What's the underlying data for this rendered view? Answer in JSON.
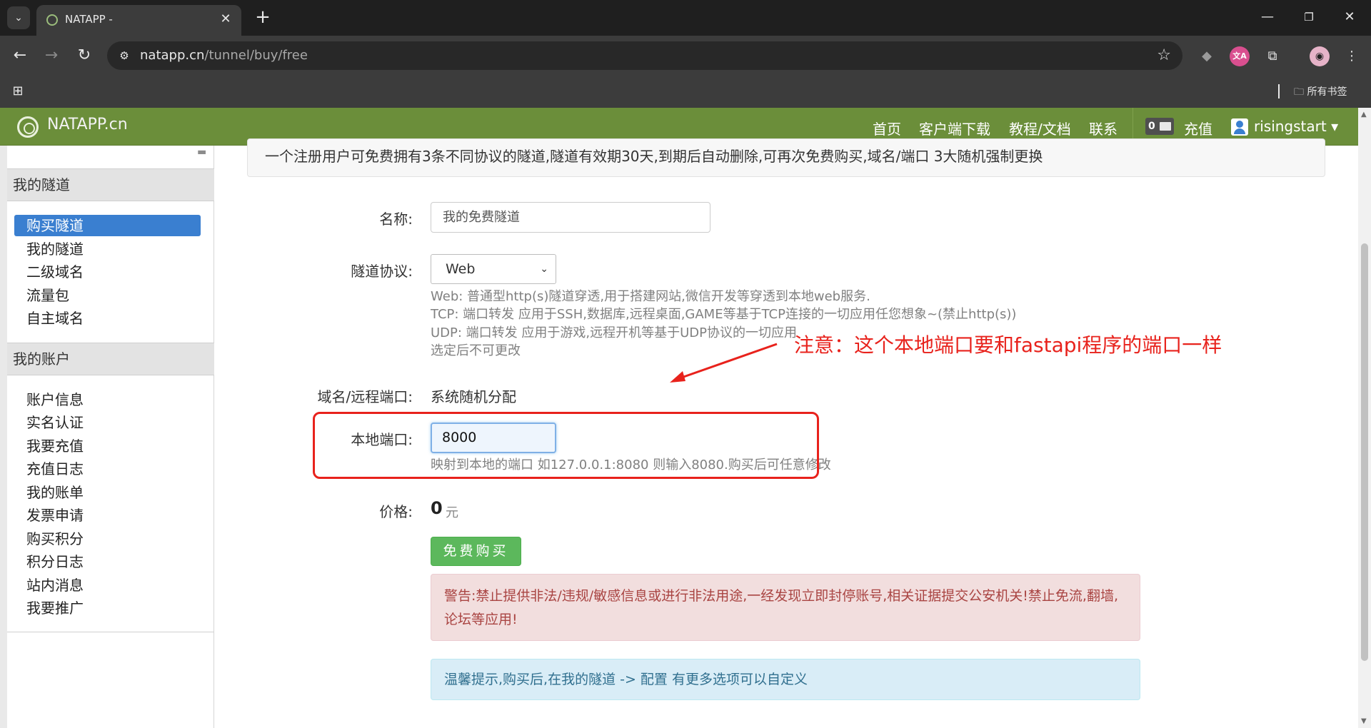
{
  "browser": {
    "tab_title": "NATAPP -",
    "url_host": "natapp.cn",
    "url_path": "/tunnel/buy/free",
    "bookmark_folder": "所有书签"
  },
  "site": {
    "brand": "NATAPP.cn",
    "nav": [
      "首页",
      "客户端下载",
      "教程/文档",
      "联系"
    ],
    "message_count": "0",
    "recharge": "充值",
    "username": "risingstart"
  },
  "sidebar": {
    "section1_title": "我的隧道",
    "section1_items": [
      "购买隧道",
      "我的隧道",
      "二级域名",
      "流量包",
      "自主域名"
    ],
    "section2_title": "我的账户",
    "section2_items": [
      "账户信息",
      "实名认证",
      "我要充值",
      "充值日志",
      "我的账单",
      "发票申请",
      "购买积分",
      "积分日志",
      "站内消息",
      "我要推广"
    ]
  },
  "main": {
    "notice": "一个注册用户可免费拥有3条不同协议的隧道,隧道有效期30天,到期后自动删除,可再次免费购买,域名/端口 3大随机强制更换",
    "name_label": "名称:",
    "name_value": "我的免费隧道",
    "protocol_label": "隧道协议:",
    "protocol_value": "Web",
    "protocol_help": [
      "Web: 普通型http(s)隧道穿透,用于搭建网站,微信开发等穿透到本地web服务.",
      "TCP: 端口转发 应用于SSH,数据库,远程桌面,GAME等基于TCP连接的一切应用任您想象~(禁止http(s))",
      "UDP: 端口转发 应用于游戏,远程开机等基于UDP协议的一切应用",
      "选定后不可更改"
    ],
    "domain_label": "域名/远程端口:",
    "domain_value": "系统随机分配",
    "local_port_label": "本地端口:",
    "local_port_value": "8000",
    "local_port_help": "映射到本地的端口 如127.0.0.1:8080 则输入8080.购买后可任意修改",
    "price_label": "价格:",
    "price_value": "0",
    "price_unit": "元",
    "buy_button": "免费购买",
    "warning": "警告:禁止提供非法/违规/敏感信息或进行非法用途,一经发现立即封停账号,相关证据提交公安机关!禁止免流,翻墙,论坛等应用!",
    "tip": "温馨提示,购买后,在我的隧道 -> 配置 有更多选项可以自定义",
    "annotation": "注意：这个本地端口要和fastapi程序的端口一样"
  }
}
